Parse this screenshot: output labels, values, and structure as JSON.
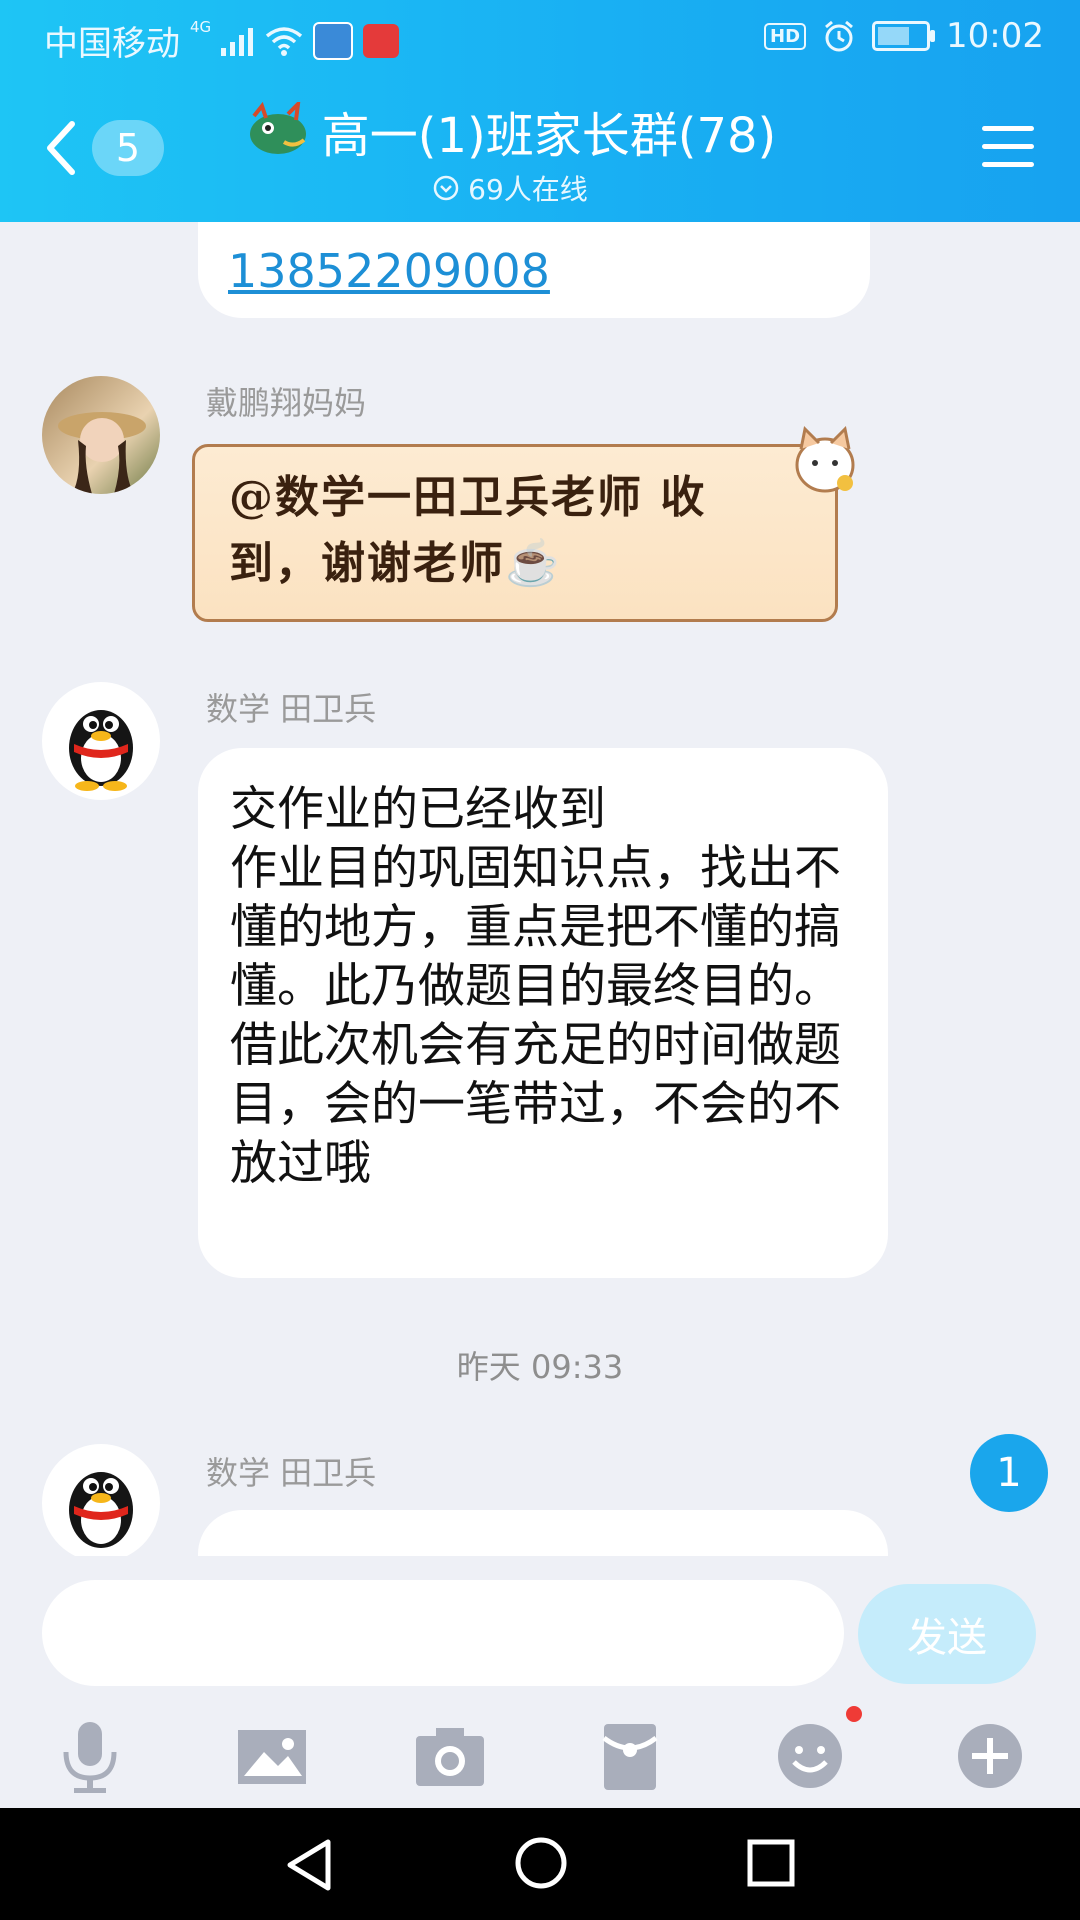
{
  "status_bar": {
    "carrier": "中国移动",
    "network": "4G",
    "time": "10:02",
    "hd_label": "HD"
  },
  "header": {
    "back_count": "5",
    "title": "高一(1)班家长群(78)",
    "online": "69人在线"
  },
  "messages": {
    "m1": {
      "phone": "13852209008"
    },
    "m2": {
      "sender": "戴鹏翔妈妈",
      "text": "@数学一田卫兵老师 收到，谢谢老师☕"
    },
    "m3": {
      "sender": "数学 田卫兵",
      "text": "交作业的已经收到\n作业目的巩固知识点，找出不懂的地方，重点是把不懂的搞懂。此乃做题目的最终目的。\n借此次机会有充足的时间做题目，会的一笔带过，不会的不放过哦"
    },
    "timestamp": "昨天 09:33",
    "m4": {
      "sender": "数学 田卫兵"
    }
  },
  "new_message_count": "1",
  "input": {
    "placeholder": "",
    "value": "",
    "send_label": "发送"
  },
  "toolbar": {
    "icons": [
      "microphone-icon",
      "image-icon",
      "camera-icon",
      "red-packet-icon",
      "emoji-icon",
      "plus-icon"
    ]
  },
  "colors": {
    "header_blue": "#19b0f3",
    "link_blue": "#1d8fd6",
    "send_button_disabled": "#c5ecfb",
    "badge_blue": "#1aa6ec"
  }
}
